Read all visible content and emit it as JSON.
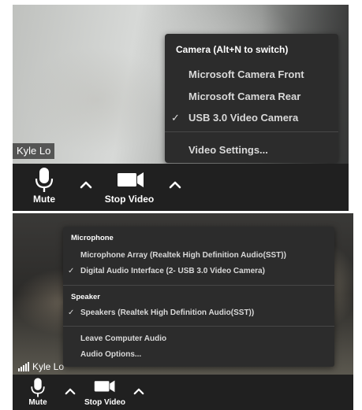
{
  "top_panel": {
    "participant_name": "Kyle Lo",
    "camera_menu": {
      "heading": "Camera (Alt+N to switch)",
      "items": [
        {
          "label": "Microsoft Camera Front",
          "checked": false
        },
        {
          "label": "Microsoft Camera Rear",
          "checked": false
        },
        {
          "label": "USB 3.0 Video Camera",
          "checked": true
        }
      ],
      "settings_label": "Video Settings...",
      "check_mark": "✓"
    },
    "toolbar": {
      "mute_label": "Mute",
      "stop_video_label": "Stop Video",
      "icons": [
        "microphone-icon",
        "caret-up-icon",
        "video-camera-icon",
        "caret-up-icon"
      ]
    }
  },
  "bottom_panel": {
    "participant_name": "Kyle Lo",
    "audio_menu": {
      "microphone_heading": "Microphone",
      "microphones": [
        {
          "label": "Microphone Array (Realtek High Definition Audio(SST))",
          "checked": false
        },
        {
          "label": "Digital Audio Interface (2- USB 3.0 Video Camera)",
          "checked": true
        }
      ],
      "speaker_heading": "Speaker",
      "speakers": [
        {
          "label": "Speakers (Realtek High Definition Audio(SST))",
          "checked": true
        }
      ],
      "leave_audio_label": "Leave Computer Audio",
      "audio_options_label": "Audio Options...",
      "check_mark": "✓"
    },
    "toolbar": {
      "mute_label": "Mute",
      "stop_video_label": "Stop Video",
      "icons": [
        "signal-strength-icon",
        "microphone-icon",
        "caret-up-icon",
        "video-camera-icon",
        "caret-up-icon"
      ]
    }
  },
  "colors": {
    "toolbar_bg": "#202020",
    "menu_bg": "#2c2c2c",
    "menu_text": "#d9d9d9"
  }
}
